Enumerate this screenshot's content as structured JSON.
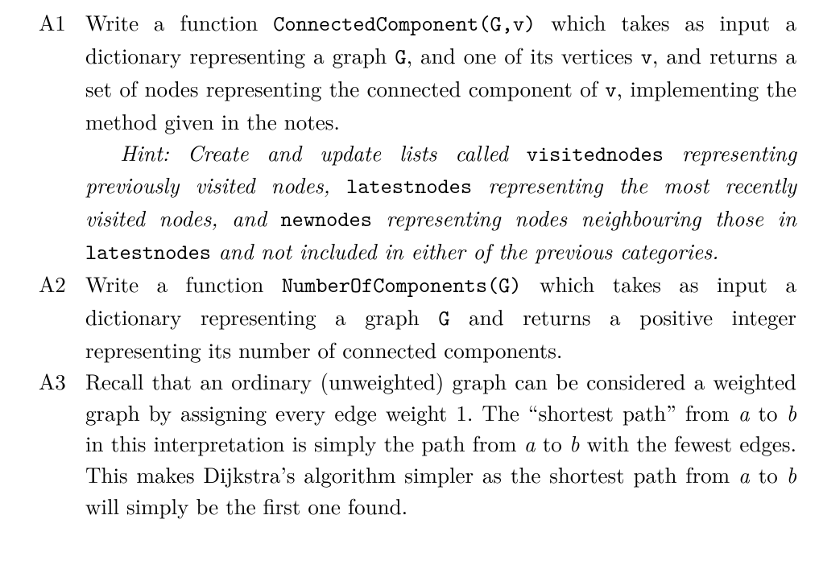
{
  "items": [
    {
      "label": "A1",
      "paragraphs": [
        {
          "type": "normal",
          "runs": [
            {
              "t": "Write a function "
            },
            {
              "t": "ConnectedComponent(G,v)",
              "tt": true
            },
            {
              "t": " which takes as input a dictionary representing a graph "
            },
            {
              "t": "G",
              "tt": true
            },
            {
              "t": ", and one of its vertices "
            },
            {
              "t": "v",
              "tt": true
            },
            {
              "t": ", and returns a set of nodes representing the connected component of "
            },
            {
              "t": "v",
              "tt": true
            },
            {
              "t": ", implementing the method given in the notes."
            }
          ]
        },
        {
          "type": "hint",
          "runs": [
            {
              "t": "Hint: Create and update lists called "
            },
            {
              "t": "visitednodes",
              "tt": true
            },
            {
              "t": " representing previously visited nodes, "
            },
            {
              "t": "latestnodes",
              "tt": true
            },
            {
              "t": " representing the most recently visited nodes, and "
            },
            {
              "t": "newnodes",
              "tt": true
            },
            {
              "t": " representing nodes neighbouring those in "
            },
            {
              "t": "latestnodes",
              "tt": true
            },
            {
              "t": " and not included in either of the previous categories."
            }
          ]
        }
      ]
    },
    {
      "label": "A2",
      "paragraphs": [
        {
          "type": "normal",
          "runs": [
            {
              "t": "Write a function "
            },
            {
              "t": "NumberOfComponents(G)",
              "tt": true
            },
            {
              "t": " which takes as input a dictionary representing a graph "
            },
            {
              "t": "G",
              "tt": true
            },
            {
              "t": " and returns a positive integer representing its number of connected components."
            }
          ]
        }
      ]
    },
    {
      "label": "A3",
      "paragraphs": [
        {
          "type": "normal",
          "runs": [
            {
              "t": "Recall that an ordinary (unweighted) graph can be considered a weighted graph by assigning every edge weight 1. The “shortest path” from "
            },
            {
              "t": "a",
              "mi": true
            },
            {
              "t": " to "
            },
            {
              "t": "b",
              "mi": true
            },
            {
              "t": " in this interpretation is simply the path from "
            },
            {
              "t": "a",
              "mi": true
            },
            {
              "t": " to "
            },
            {
              "t": "b",
              "mi": true
            },
            {
              "t": " with the fewest edges. This makes Dijkstra’s algorithm simpler as the shortest path from "
            },
            {
              "t": "a",
              "mi": true
            },
            {
              "t": " to "
            },
            {
              "t": "b",
              "mi": true
            },
            {
              "t": " will simply be the first one found."
            }
          ]
        }
      ]
    }
  ]
}
